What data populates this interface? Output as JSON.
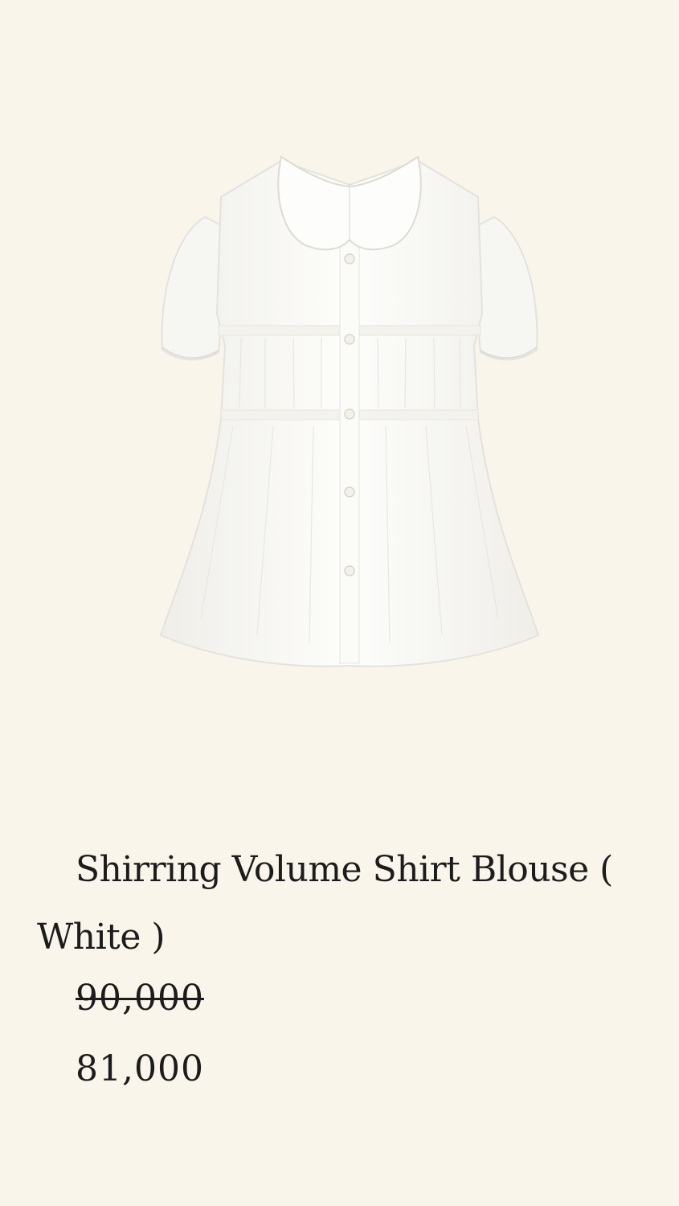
{
  "product": {
    "title": "Shirring Volume Shirt Blouse ( White )",
    "image_alt": "white short-sleeve shirring blouse with peter pan collar",
    "price_original": "90,000",
    "price_sale": "81,000",
    "colors": {
      "background": "#f9f5eb",
      "garment": "#fbfbf8",
      "text": "#1c1c1c"
    }
  }
}
